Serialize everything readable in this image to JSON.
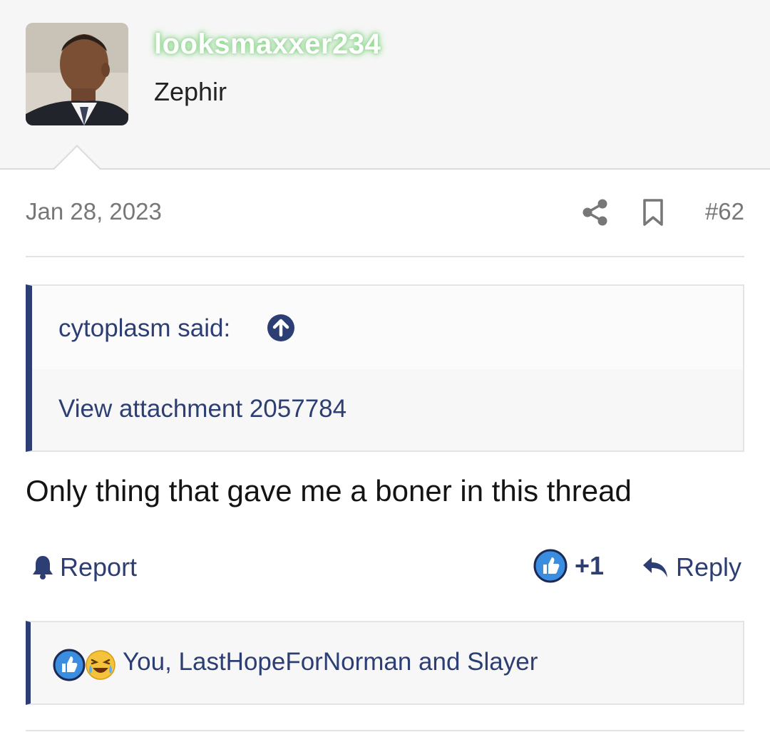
{
  "user": {
    "username": "looksmaxxer234",
    "title": "Zephir",
    "avatar_icon": "user-avatar-photo"
  },
  "post": {
    "date": "Jan 28, 2023",
    "number": "#62",
    "text": "Only thing that gave me a boner in this thread"
  },
  "quote": {
    "author_line": "cytoplasm said:",
    "body": "View attachment 2057784"
  },
  "actions": {
    "report_label": "Report",
    "like_count": "+1",
    "reply_label": "Reply"
  },
  "reactions": {
    "users_text": "You, LastHopeForNorman and Slayer",
    "icons": [
      "like-icon",
      "laughing-crying-icon"
    ]
  },
  "colors": {
    "accent": "#2c3e73",
    "username_glow": "#8fd48f",
    "like_blue": "#3b8de0"
  }
}
